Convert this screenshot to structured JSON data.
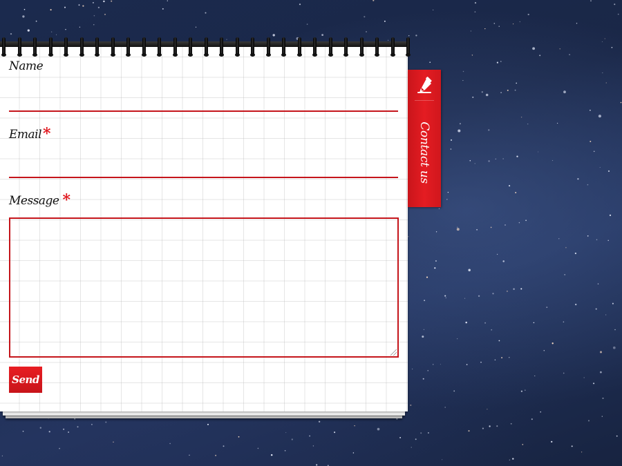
{
  "form": {
    "name_label": "Name",
    "email_label": "Email",
    "message_label": "Message",
    "required_marker": "*",
    "send_label": "Send",
    "name_value": "",
    "email_value": "",
    "message_value": ""
  },
  "contact_tab": {
    "label": "Contact us",
    "icon": "pen-icon"
  },
  "colors": {
    "accent": "#e0141b",
    "background": "#1b2a4e",
    "paper": "#ffffff"
  }
}
